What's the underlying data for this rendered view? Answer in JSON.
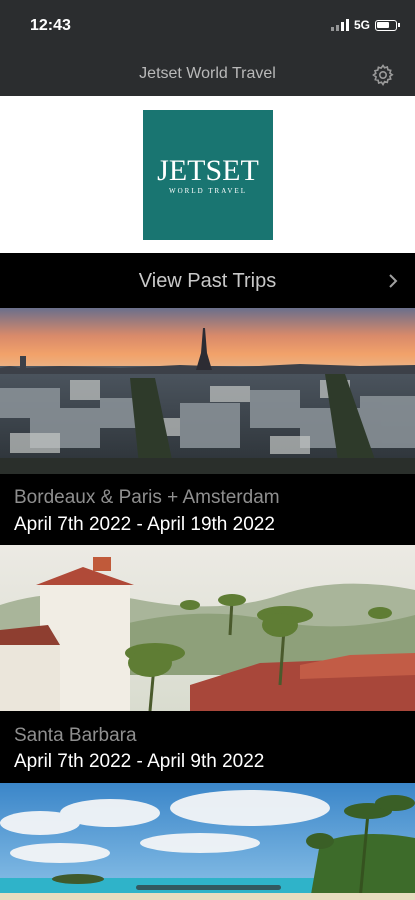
{
  "status_bar": {
    "time": "12:43",
    "network": "5G"
  },
  "header": {
    "title": "Jetset World Travel"
  },
  "logo": {
    "main": "JETSET",
    "sub": "WORLD TRAVEL"
  },
  "past_trips": {
    "label": "View Past Trips"
  },
  "trips": [
    {
      "name": "Bordeaux & Paris + Amsterdam",
      "dates": "April 7th 2022 - April 19th 2022"
    },
    {
      "name": "Santa Barbara",
      "dates": "April 7th 2022 - April 9th 2022"
    }
  ]
}
